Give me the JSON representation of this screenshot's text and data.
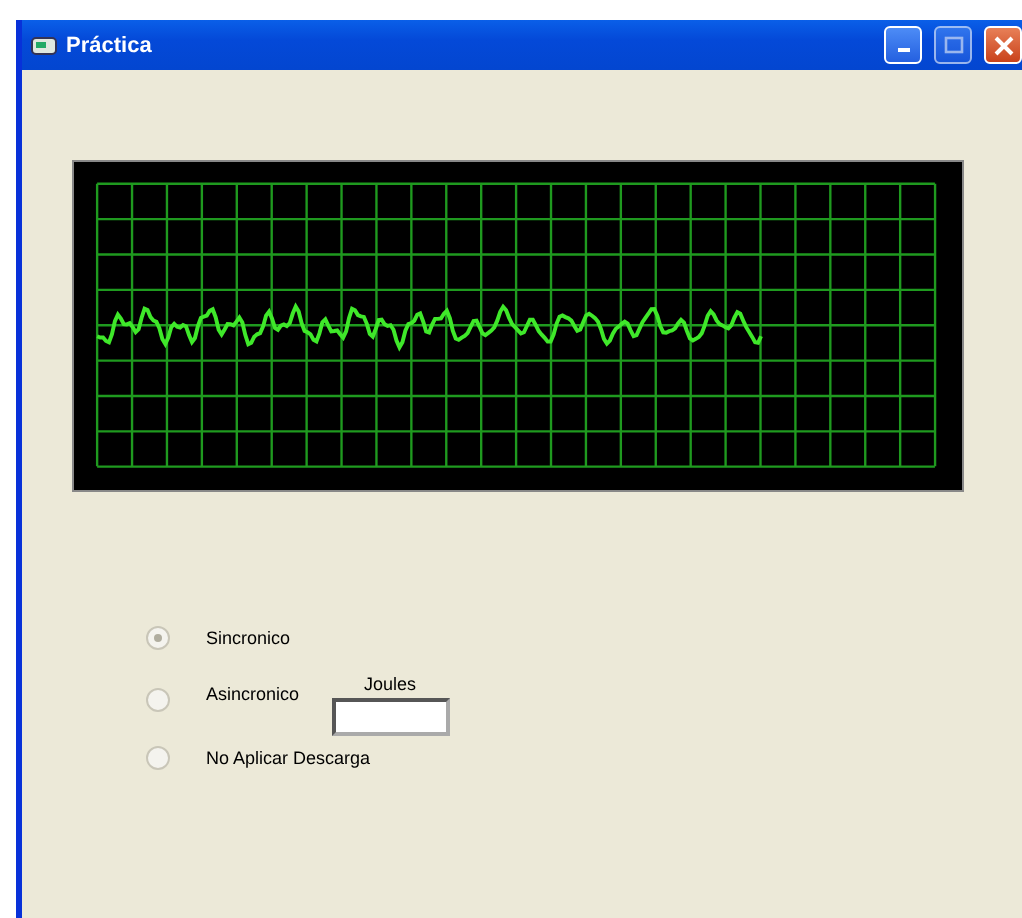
{
  "window": {
    "title": "Práctica"
  },
  "options": [
    {
      "label": "Sincronico",
      "selected": true
    },
    {
      "label": "Asincronico",
      "selected": false
    },
    {
      "label": "No Aplicar Descarga",
      "selected": false
    }
  ],
  "joules": {
    "label": "Joules"
  }
}
